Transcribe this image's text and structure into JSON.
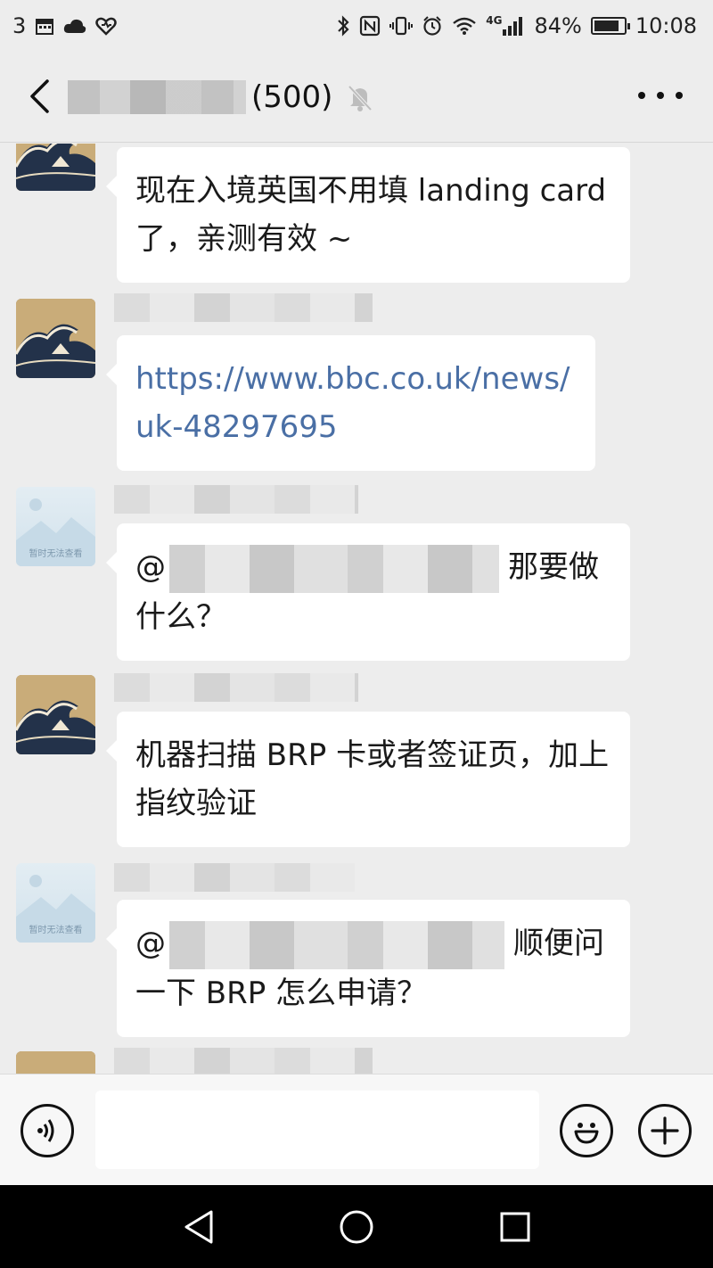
{
  "status_bar": {
    "left_text": "3",
    "battery": "84%",
    "battery_level": 0.84,
    "time": "10:08",
    "network": "4G"
  },
  "header": {
    "count": "(500)"
  },
  "messages": [
    {
      "text": "现在入境英国不用填 landing card 了，亲测有效 ~"
    },
    {
      "text": "https://www.bbc.co.uk/news/uk-48297695"
    },
    {
      "prefix": "@",
      "text": "那要做什么？"
    },
    {
      "text": "机器扫描 BRP 卡或者签证页，加上指纹验证"
    },
    {
      "prefix": "@",
      "text": "顺便问一下 BRP 怎么申请？"
    }
  ],
  "avatar_placeholder_text": "暂时无法查看",
  "input": {
    "value": "",
    "placeholder": ""
  },
  "icons": {
    "back": "back-arrow-icon",
    "mute": "bell-muted-icon",
    "more": "more-icon",
    "voice": "voice-icon",
    "emoji": "emoji-icon",
    "add": "plus-icon"
  }
}
